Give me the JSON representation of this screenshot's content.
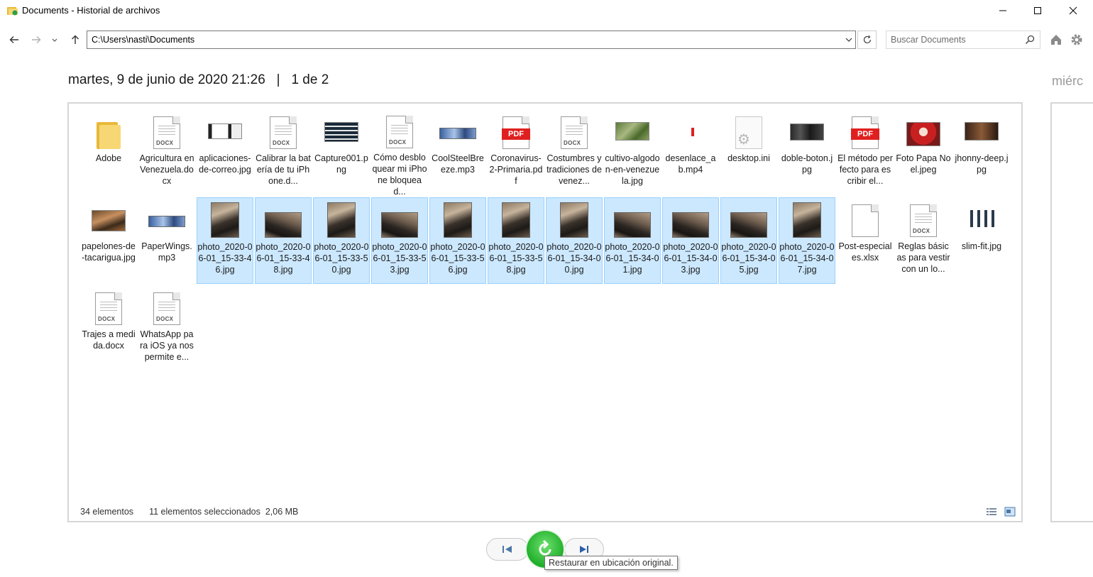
{
  "window": {
    "title": "Documents - Historial de archivos"
  },
  "nav": {
    "address": "C:\\Users\\nasti\\Documents",
    "search_placeholder": "Buscar Documents"
  },
  "header": {
    "date": "martes, 9 de junio de 2020 21:26",
    "separator": "|",
    "page": "1 de 2",
    "next_date_partial": "miérc"
  },
  "files": [
    {
      "name": "Adobe",
      "icon": "folder-icon",
      "selected": false
    },
    {
      "name": "Agricultura en Venezuela.docx",
      "icon": "docx-icon",
      "selected": false
    },
    {
      "name": "aplicaciones-de-correo.jpg",
      "icon": "image-icon",
      "selected": false
    },
    {
      "name": "Calibrar la batería de tu iPhone.d...",
      "icon": "docx-icon",
      "selected": false
    },
    {
      "name": "Capture001.png",
      "icon": "image-icon",
      "selected": false
    },
    {
      "name": "Cómo desbloquear mi iPhone bloquead...",
      "icon": "docx-icon",
      "selected": false
    },
    {
      "name": "CoolSteelBreeze.mp3",
      "icon": "audio-icon",
      "selected": false
    },
    {
      "name": "Coronavirus-2-Primaria.pdf",
      "icon": "pdf-icon",
      "selected": false
    },
    {
      "name": "Costumbres y tradiciones de venez...",
      "icon": "docx-icon",
      "selected": false
    },
    {
      "name": "cultivo-algodon-en-venezuela.jpg",
      "icon": "image-icon",
      "selected": false
    },
    {
      "name": "desenlace_ab.mp4",
      "icon": "video-icon",
      "selected": false
    },
    {
      "name": "desktop.ini",
      "icon": "settings-file-icon",
      "selected": false
    },
    {
      "name": "doble-boton.jpg",
      "icon": "image-icon",
      "selected": false
    },
    {
      "name": "El método perfecto para escribir el...",
      "icon": "pdf-icon",
      "selected": false
    },
    {
      "name": "Foto Papa Noel.jpeg",
      "icon": "image-icon",
      "selected": false
    },
    {
      "name": "jhonny-deep.jpg",
      "icon": "image-icon",
      "selected": false
    },
    {
      "name": "papelones-de-tacarigua.jpg",
      "icon": "image-icon",
      "selected": false
    },
    {
      "name": "PaperWings.mp3",
      "icon": "audio-icon",
      "selected": false
    },
    {
      "name": "photo_2020-06-01_15-33-46.jpg",
      "icon": "image-icon",
      "selected": true
    },
    {
      "name": "photo_2020-06-01_15-33-48.jpg",
      "icon": "image-icon",
      "selected": true
    },
    {
      "name": "photo_2020-06-01_15-33-50.jpg",
      "icon": "image-icon",
      "selected": true
    },
    {
      "name": "photo_2020-06-01_15-33-53.jpg",
      "icon": "image-icon",
      "selected": true
    },
    {
      "name": "photo_2020-06-01_15-33-56.jpg",
      "icon": "image-icon",
      "selected": true
    },
    {
      "name": "photo_2020-06-01_15-33-58.jpg",
      "icon": "image-icon",
      "selected": true
    },
    {
      "name": "photo_2020-06-01_15-34-00.jpg",
      "icon": "image-icon",
      "selected": true
    },
    {
      "name": "photo_2020-06-01_15-34-01.jpg",
      "icon": "image-icon",
      "selected": true
    },
    {
      "name": "photo_2020-06-01_15-34-03.jpg",
      "icon": "image-icon",
      "selected": true
    },
    {
      "name": "photo_2020-06-01_15-34-05.jpg",
      "icon": "image-icon",
      "selected": true
    },
    {
      "name": "photo_2020-06-01_15-34-07.jpg",
      "icon": "image-icon",
      "selected": true
    },
    {
      "name": "Post-especiales.xlsx",
      "icon": "blank-file-icon",
      "selected": false
    },
    {
      "name": "Reglas básicas para vestir con un lo...",
      "icon": "docx-icon",
      "selected": false
    },
    {
      "name": "slim-fit.jpg",
      "icon": "image-icon",
      "selected": false
    },
    {
      "name": "Trajes a medida.docx",
      "icon": "docx-icon",
      "selected": false
    },
    {
      "name": "WhatsApp para iOS ya nos permite e...",
      "icon": "docx-icon",
      "selected": false
    }
  ],
  "status": {
    "count": "34 elementos",
    "selected": "11 elementos seleccionados  2,06 MB"
  },
  "controls": {
    "tooltip": "Restaurar en ubicación original."
  },
  "colors": {
    "selection_bg": "#cce8ff",
    "selection_border": "#99d1ff",
    "restore_green": "#1fae2a"
  }
}
